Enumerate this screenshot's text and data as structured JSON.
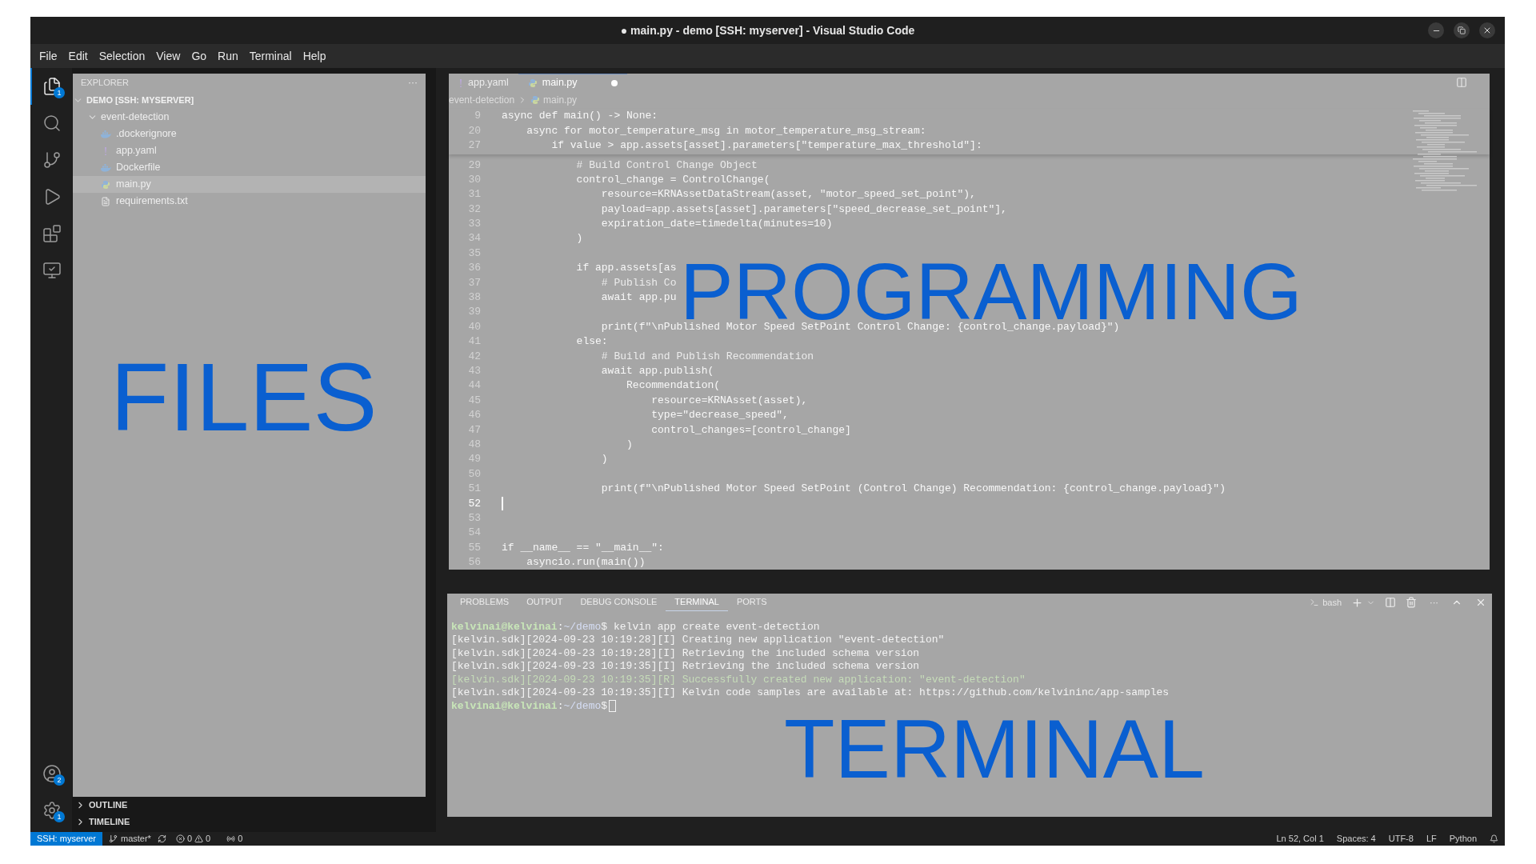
{
  "window": {
    "title": "● main.py - demo [SSH: myserver] - Visual Studio Code"
  },
  "menu": [
    "File",
    "Edit",
    "Selection",
    "View",
    "Go",
    "Run",
    "Terminal",
    "Help"
  ],
  "activity_bar": [
    {
      "kind": "explorer",
      "selected": true,
      "badge": "1"
    },
    {
      "kind": "search",
      "selected": false
    },
    {
      "kind": "source-control",
      "selected": false
    },
    {
      "kind": "run",
      "selected": false
    },
    {
      "kind": "extensions",
      "selected": false
    },
    {
      "kind": "remote",
      "selected": false
    },
    {
      "kind": "accounts",
      "selected": false,
      "badge": "2"
    },
    {
      "kind": "settings",
      "selected": false,
      "badge": "1"
    }
  ],
  "explorer": {
    "title": "EXPLORER",
    "more": "···",
    "root": {
      "label": "DEMO [SSH: MYSERVER]",
      "expanded": true,
      "children": [
        {
          "label": "event-detection",
          "expanded": true,
          "children": [
            {
              "label": ".dockerignore",
              "kind": "docker",
              "selected": false
            },
            {
              "label": "app.yaml",
              "kind": "yaml",
              "selected": false
            },
            {
              "label": "Dockerfile",
              "kind": "docker",
              "selected": false
            },
            {
              "label": "main.py",
              "kind": "python",
              "selected": true
            },
            {
              "label": "requirements.txt",
              "kind": "text",
              "selected": false
            }
          ]
        }
      ]
    },
    "sections": [
      {
        "label": "OUTLINE",
        "expanded": false
      },
      {
        "label": "TIMELINE",
        "expanded": false
      }
    ]
  },
  "editor": {
    "tabs": [
      {
        "label": "app.yaml",
        "kind": "yaml",
        "selected": false,
        "modified": false
      },
      {
        "label": "main.py",
        "kind": "python",
        "selected": true,
        "modified": true
      }
    ],
    "breadcrumbs": [
      "event-detection",
      "main.py"
    ],
    "sticky_lines": [
      {
        "number": "9",
        "text": "async def main() -> None:",
        "kind": "code"
      },
      {
        "number": "20",
        "text": "    async for motor_temperature_msg in motor_temperature_msg_stream:",
        "kind": "code"
      },
      {
        "number": "27",
        "text": "        if value > app.assets[asset].parameters[\"temperature_max_threshold\"]:",
        "kind": "code"
      }
    ],
    "lines": [
      {
        "number": "29",
        "text": "            # Build Control Change Object",
        "kind": "comment"
      },
      {
        "number": "30",
        "text": "            control_change = ControlChange(",
        "kind": "code"
      },
      {
        "number": "31",
        "text": "                resource=KRNAssetDataStream(asset, \"motor_speed_set_point\"),",
        "kind": "code"
      },
      {
        "number": "32",
        "text": "                payload=app.assets[asset].parameters[\"speed_decrease_set_point\"],",
        "kind": "code"
      },
      {
        "number": "33",
        "text": "                expiration_date=timedelta(minutes=10)",
        "kind": "code"
      },
      {
        "number": "34",
        "text": "            )",
        "kind": "code"
      },
      {
        "number": "35",
        "kind": "code"
      },
      {
        "number": "36",
        "text": "            if app.assets[as",
        "kind": "code"
      },
      {
        "number": "37",
        "text": "                # Publish Co",
        "kind": "comment"
      },
      {
        "number": "38",
        "text": "                await app.pu",
        "kind": "code"
      },
      {
        "number": "39",
        "kind": "code"
      },
      {
        "number": "40",
        "text": "                print(f\"\\nPublished Motor Speed SetPoint Control Change: {control_change.payload}\")",
        "kind": "code"
      },
      {
        "number": "41",
        "text": "            else:",
        "kind": "code"
      },
      {
        "number": "42",
        "text": "                # Build and Publish Recommendation",
        "kind": "comment"
      },
      {
        "number": "43",
        "text": "                await app.publish(",
        "kind": "code"
      },
      {
        "number": "44",
        "text": "                    Recommendation(",
        "kind": "code"
      },
      {
        "number": "45",
        "text": "                        resource=KRNAsset(asset),",
        "kind": "code"
      },
      {
        "number": "46",
        "text": "                        type=\"decrease_speed\",",
        "kind": "code"
      },
      {
        "number": "47",
        "text": "                        control_changes=[control_change]",
        "kind": "code"
      },
      {
        "number": "48",
        "text": "                    )",
        "kind": "code"
      },
      {
        "number": "49",
        "text": "                )",
        "kind": "code"
      },
      {
        "number": "50",
        "kind": "code"
      },
      {
        "number": "51",
        "text": "                print(f\"\\nPublished Motor Speed SetPoint (Control Change) Recommendation: {control_change.payload}\")",
        "kind": "code"
      },
      {
        "number": "52",
        "kind": "cursor"
      },
      {
        "number": "53",
        "kind": "code"
      },
      {
        "number": "54",
        "kind": "code"
      },
      {
        "number": "55",
        "text": "if __name__ == \"__main__\":",
        "kind": "code"
      },
      {
        "number": "56",
        "text": "    asyncio.run(main())",
        "kind": "code"
      }
    ]
  },
  "panel": {
    "tabs": [
      {
        "label": "PROBLEMS",
        "selected": false
      },
      {
        "label": "OUTPUT",
        "selected": false
      },
      {
        "label": "DEBUG CONSOLE",
        "selected": false
      },
      {
        "label": "TERMINAL",
        "selected": true
      },
      {
        "label": "PORTS",
        "selected": false
      }
    ],
    "shell": "bash",
    "more": "···",
    "lines": [
      {
        "kind": "prompt",
        "user": "kelvinai@kelvinai",
        "separator": ":",
        "path": "~/demo",
        "sign": "$",
        "command": "kelvin app create event-detection"
      },
      {
        "kind": "log",
        "text": "[kelvin.sdk][2024-09-23 10:19:28][I] Creating new application \"event-detection\""
      },
      {
        "kind": "log",
        "text": "[kelvin.sdk][2024-09-23 10:19:28][I] Retrieving the included schema version"
      },
      {
        "kind": "log",
        "text": "[kelvin.sdk][2024-09-23 10:19:35][I] Retrieving the included schema version"
      },
      {
        "kind": "success",
        "text": "[kelvin.sdk][2024-09-23 10:19:35][R] Successfully created new application: \"event-detection\""
      },
      {
        "kind": "log",
        "text": "[kelvin.sdk][2024-09-23 10:19:35][I] Kelvin code samples are available at: https://github.com/kelvininc/app-samples"
      },
      {
        "kind": "prompt",
        "user": "kelvinai@kelvinai",
        "separator": ":",
        "path": "~/demo",
        "sign": "$"
      }
    ]
  },
  "overlay_labels": [
    {
      "kind": "files",
      "text": "FILES"
    },
    {
      "kind": "programming",
      "text": "PROGRAMMING"
    },
    {
      "kind": "terminal",
      "text": "TERMINAL"
    }
  ],
  "status_bar": {
    "remote": "SSH: myserver",
    "branch": "master*",
    "errors": "0",
    "warnings": "0",
    "ports": "0",
    "right": [
      "Ln 52, Col 1",
      "Spaces: 4",
      "UTF-8",
      "LF",
      "Python"
    ]
  }
}
